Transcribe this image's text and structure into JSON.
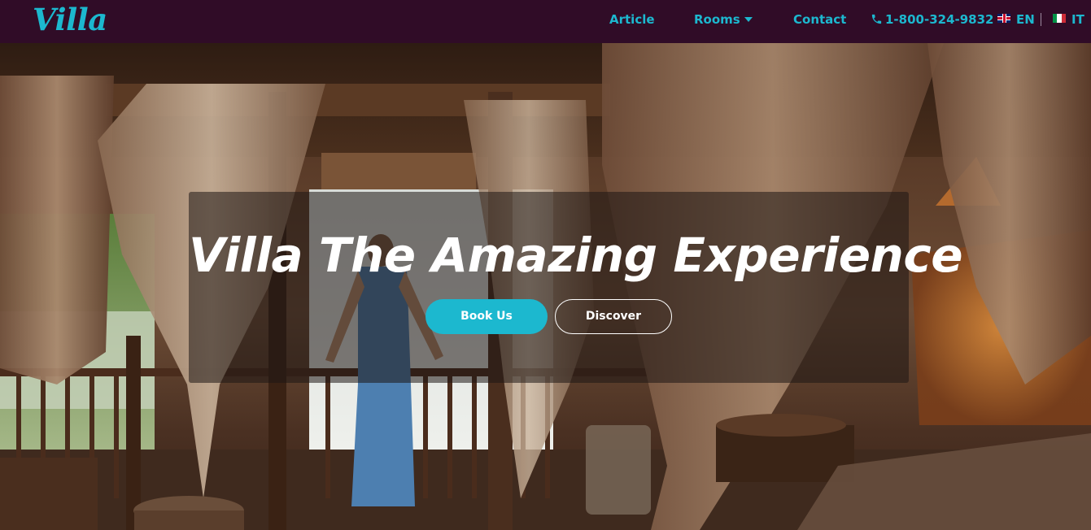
{
  "navbar": {
    "brand": "Villa",
    "links": [
      {
        "label": "Article"
      },
      {
        "label": "Rooms"
      },
      {
        "label": "Contact"
      }
    ],
    "phone": "1-800-324-9832",
    "languages": [
      {
        "code": "EN"
      },
      {
        "code": "IT"
      }
    ]
  },
  "hero": {
    "title": "Villa The Amazing Experience",
    "primary_button": "Book Us",
    "secondary_button": "Discover"
  },
  "colors": {
    "accent": "#1cb8cf",
    "navbar_bg": "#300c27",
    "text_light": "#ffffff"
  },
  "icons": [
    "phone-icon",
    "uk-flag-icon",
    "italy-flag-icon",
    "caret-down-icon"
  ]
}
